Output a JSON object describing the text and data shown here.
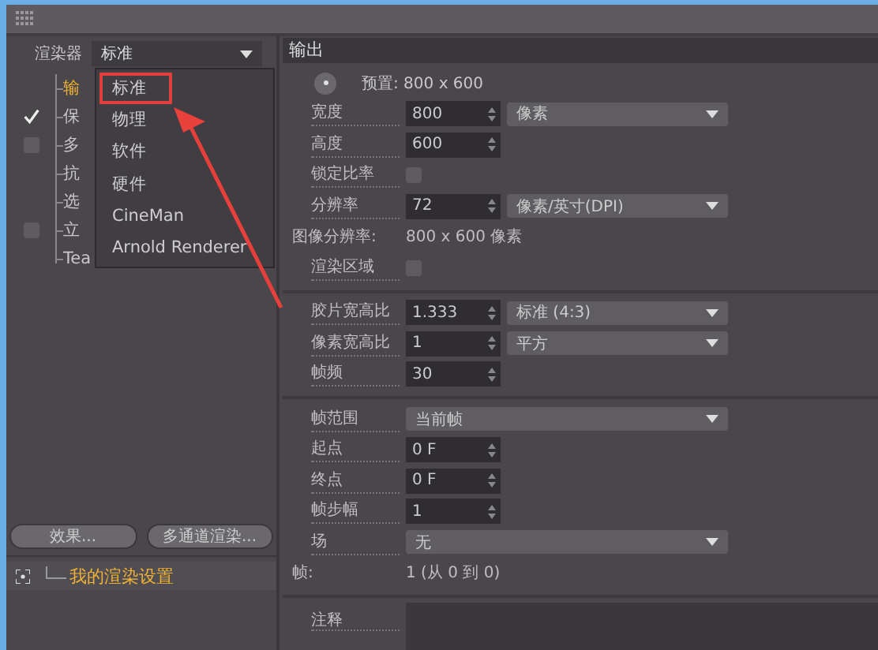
{
  "renderer": {
    "label": "渲染器",
    "value": "标准"
  },
  "renderer_menu": [
    {
      "label": "标准",
      "highlighted": true
    },
    {
      "label": "物理",
      "highlighted": false
    },
    {
      "label": "软件",
      "highlighted": false
    },
    {
      "label": "硬件",
      "highlighted": false
    },
    {
      "label": "CineMan",
      "highlighted": false
    },
    {
      "label": "Arnold Renderer",
      "highlighted": false
    }
  ],
  "settings_list": [
    {
      "label": "输",
      "kind": "plain",
      "selected": true
    },
    {
      "label": "保",
      "kind": "check",
      "checked": true,
      "selected": false
    },
    {
      "label": "多",
      "kind": "check",
      "checked": false,
      "selected": false
    },
    {
      "label": "抗",
      "kind": "plain",
      "selected": false
    },
    {
      "label": "选",
      "kind": "plain",
      "selected": false
    },
    {
      "label": "立",
      "kind": "check",
      "checked": false,
      "selected": false
    },
    {
      "label": "Tea",
      "kind": "plain",
      "selected": false
    }
  ],
  "buttons": [
    "效果...",
    "多通道渲染..."
  ],
  "presets": [
    {
      "label": "我的渲染设置",
      "selected": true
    }
  ],
  "output": {
    "title": "输出",
    "groups": [
      [
        {
          "kind": "preset",
          "text": "预置: 800 x 600"
        },
        {
          "kind": "field",
          "label": "宽度",
          "value": "800",
          "unit": "像素"
        },
        {
          "kind": "field",
          "label": "高度",
          "value": "600"
        },
        {
          "kind": "check",
          "label": "锁定比率",
          "checked": false
        },
        {
          "kind": "field",
          "label": "分辨率",
          "value": "72",
          "unit": "像素/英寸(DPI)"
        },
        {
          "kind": "info",
          "label": "图像分辨率:",
          "value": "800 x 600 像素"
        },
        {
          "kind": "check",
          "label": "渲染区域",
          "checked": false
        }
      ],
      [
        {
          "kind": "field",
          "label": "胶片宽高比",
          "value": "1.333",
          "unit": "标准 (4:3)"
        },
        {
          "kind": "field",
          "label": "像素宽高比",
          "value": "1",
          "unit": "平方"
        },
        {
          "kind": "field",
          "label": "帧频",
          "value": "30"
        }
      ],
      [
        {
          "kind": "select",
          "label": "帧范围",
          "value": "当前帧"
        },
        {
          "kind": "field",
          "label": "起点",
          "value": "0 F"
        },
        {
          "kind": "field",
          "label": "终点",
          "value": "0 F"
        },
        {
          "kind": "field",
          "label": "帧步幅",
          "value": "1"
        },
        {
          "kind": "select",
          "label": "场",
          "value": "无"
        },
        {
          "kind": "info",
          "label": "帧:",
          "value": "1 (从 0 到 0)"
        }
      ],
      [
        {
          "kind": "notes",
          "label": "注释"
        }
      ]
    ]
  }
}
